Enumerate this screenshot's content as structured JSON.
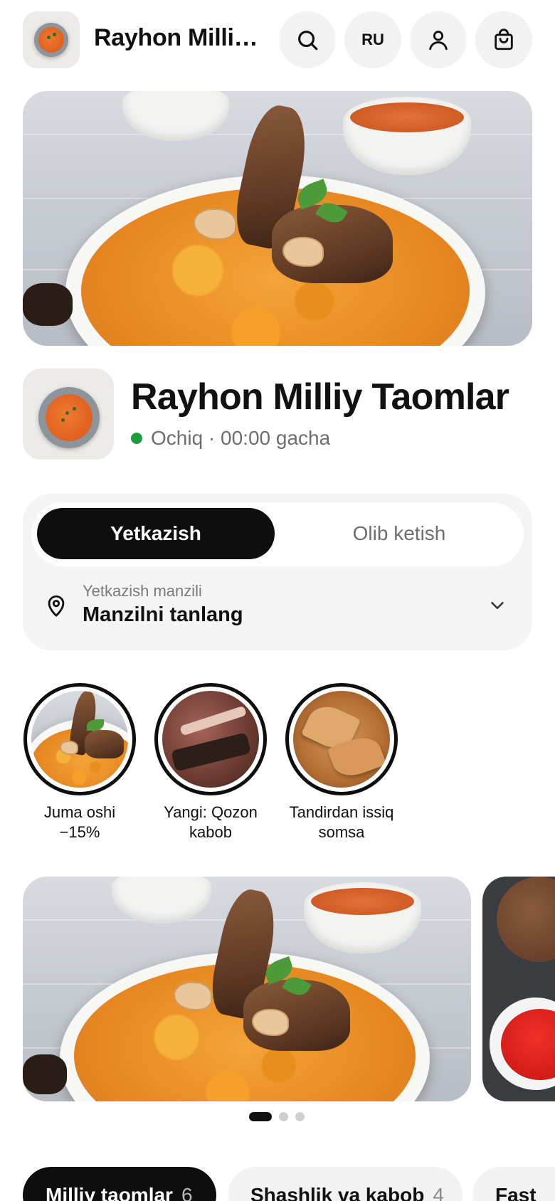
{
  "header": {
    "title": "Rayhon Milliy Taomlar",
    "language": "RU",
    "icons": [
      "search-icon",
      "user-icon",
      "shopping-bag-icon"
    ]
  },
  "restaurant": {
    "name": "Rayhon Milliy Taomlar",
    "status": "Ochiq · 00:00 gacha",
    "status_color": "#1e9d3f"
  },
  "delivery": {
    "tabs": [
      {
        "label": "Yetkazish",
        "active": true
      },
      {
        "label": "Olib ketish",
        "active": false
      }
    ],
    "address_label": "Yetkazish manzili",
    "address_value": "Manzilni tanlang"
  },
  "stories": [
    {
      "label": "Juma oshi −15%"
    },
    {
      "label": "Yangi: Qozon kabob"
    },
    {
      "label": "Tandirdan issiq somsa"
    }
  ],
  "carousel": {
    "slides_total": 3,
    "active_index": 0
  },
  "categories": [
    {
      "name": "Milliy taomlar",
      "count": "6",
      "active": true
    },
    {
      "name": "Shashlik va kabob",
      "count": "4",
      "active": false
    },
    {
      "name": "Fast",
      "count": "",
      "active": false
    }
  ],
  "colors": {
    "accent": "#0e0e0e",
    "chip_bg": "#f2f2f2",
    "card_bg": "#f4f4f4"
  }
}
